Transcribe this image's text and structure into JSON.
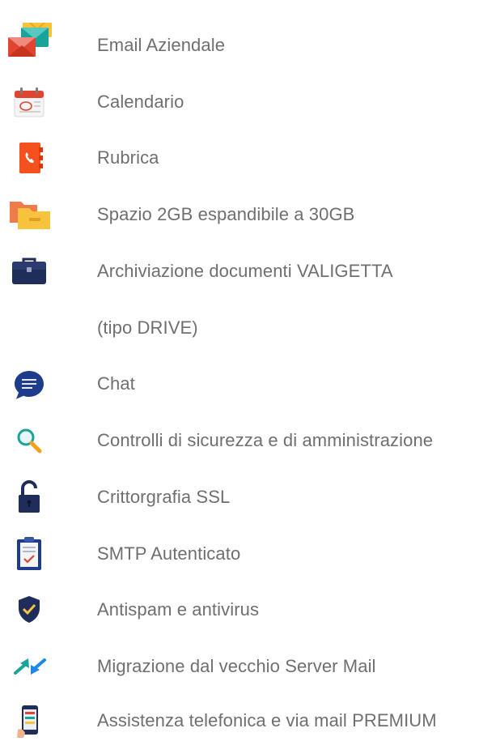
{
  "features": [
    {
      "label": "Email Aziendale",
      "icon": "email-envelopes-icon"
    },
    {
      "label": "Calendario",
      "icon": "calendar-icon"
    },
    {
      "label": "Rubrica",
      "icon": "address-book-icon"
    },
    {
      "label": "Spazio 2GB espandibile a 30GB",
      "icon": "folders-icon"
    },
    {
      "label": "Archiviazione documenti VALIGETTA",
      "icon": "briefcase-icon"
    },
    {
      "label": "(tipo DRIVE)",
      "icon": ""
    },
    {
      "label": "Chat",
      "icon": "chat-bubble-icon"
    },
    {
      "label": "Controlli di sicurezza e di amministrazione",
      "icon": "magnifier-icon"
    },
    {
      "label": "Crittorgrafia SSL",
      "icon": "padlock-icon"
    },
    {
      "label": "SMTP Autenticato",
      "icon": "clipboard-check-icon"
    },
    {
      "label": "Antispam e antivirus",
      "icon": "shield-check-icon"
    },
    {
      "label": "Migrazione dal vecchio Server Mail",
      "icon": "migration-arrows-icon"
    },
    {
      "label": "Assistenza telefonica e via mail  PREMIUM",
      "icon": "smartphone-support-icon"
    }
  ],
  "colors": {
    "text": "#6f6f6f",
    "navy": "#1f2d5a",
    "red": "#e0452f",
    "orange": "#f4511e",
    "yellow": "#f7c33c",
    "teal": "#1aa39a",
    "blue": "#1e88e5"
  }
}
